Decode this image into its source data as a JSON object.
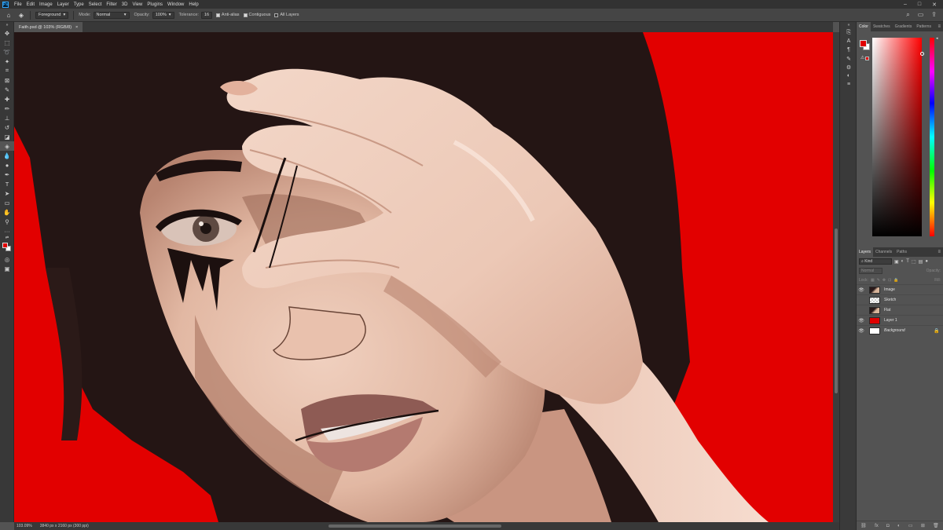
{
  "menubar": {
    "logo": "Ps",
    "items": [
      "File",
      "Edit",
      "Image",
      "Layer",
      "Type",
      "Select",
      "Filter",
      "3D",
      "View",
      "Plugins",
      "Window",
      "Help"
    ],
    "window_controls": [
      "–",
      "□",
      "✕"
    ]
  },
  "options": {
    "tool_icon": "paint-bucket-icon",
    "source_value": "Foreground",
    "mode_label": "Mode:",
    "mode_value": "Normal",
    "opacity_label": "Opacity:",
    "opacity_value": "100%",
    "tolerance_label": "Tolerance:",
    "tolerance_value": "16",
    "antialias_label": "Anti-alias",
    "antialias_checked": true,
    "contiguous_label": "Contiguous",
    "contiguous_checked": true,
    "alllayers_label": "All Layers",
    "alllayers_checked": false
  },
  "document": {
    "tab_title": "Faith.psd @ 103% (RGB/8)",
    "close": "×"
  },
  "status": {
    "zoom": "103.09%",
    "dimensions": "3840 px x 2160 px (300 ppi)"
  },
  "color_panel": {
    "tabs": [
      "Color",
      "Swatches",
      "Gradients",
      "Patterns"
    ],
    "active": "Color",
    "foreground": "#e00000",
    "background": "#ffffff"
  },
  "layers_panel": {
    "tabs": [
      "Layers",
      "Channels",
      "Paths"
    ],
    "active": "Layers",
    "kind_label": "Kind",
    "blend_mode": "Normal",
    "opacity_label": "Opacity:",
    "lock_label": "Lock:",
    "fill_label": "Fill:",
    "layers": [
      {
        "name": "Image",
        "visible": true,
        "thumb": "image"
      },
      {
        "name": "Sketch",
        "visible": false,
        "thumb": "checker"
      },
      {
        "name": "Flat",
        "visible": false,
        "thumb": "image"
      },
      {
        "name": "Layer 1",
        "visible": true,
        "thumb": "red"
      },
      {
        "name": "Background",
        "visible": true,
        "thumb": "white",
        "locked": true
      }
    ]
  },
  "colors": {
    "canvas_red": "#e20000",
    "hair": "#241514",
    "skin_light": "#f1d2c1",
    "skin_mid": "#d8a792",
    "skin_shadow": "#8a5a4a",
    "lips": "#a86a62"
  }
}
